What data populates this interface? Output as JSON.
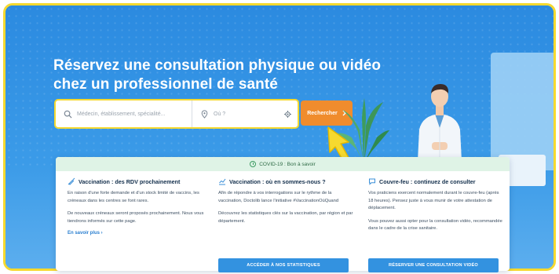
{
  "hero": {
    "headline_line1": "Réservez une consultation physique ou vidéo",
    "headline_line2": "chez un professionnel de santé"
  },
  "search": {
    "query_placeholder": "Médecin, établissement, spécialité...",
    "location_placeholder": "Où ?",
    "button_label": "Rechercher"
  },
  "banner": {
    "text": "COVID-19 : Bon à savoir"
  },
  "cards": [
    {
      "title": "Vaccination : des RDV prochainement",
      "icon": "syringe-icon",
      "paragraphs": [
        "En raison d'une forte demande et d'un stock limité de vaccins, les créneaux dans les centres se font rares.",
        "De nouveaux créneaux seront proposés prochainement. Nous vous tiendrons informés sur cette page."
      ],
      "link": "En savoir plus"
    },
    {
      "title": "Vaccination : où en sommes-nous ?",
      "icon": "chart-icon",
      "paragraphs": [
        "Afin de répondre à vos interrogations sur le rythme de la vaccination, Doctolib lance l'initiative #VaccinationOùQuand",
        "Découvrez les statistiques clés sur la vaccination, par région et par département."
      ],
      "button": "ACCÉDER À NOS STATISTIQUES"
    },
    {
      "title": "Couvre-feu : continuez de consulter",
      "icon": "chat-icon",
      "paragraphs": [
        "Vos praticiens exercent normalement durant le couvre-feu (après 18 heures). Pensez juste à vous munir de votre attestation de déplacement.",
        "Vous pouvez aussi opter pour la consultation vidéo, recommandée dans le cadre de la crise sanitaire."
      ],
      "button": "RÉSERVER UNE CONSULTATION VIDÉO"
    }
  ],
  "colors": {
    "hero_blue": "#2f8fde",
    "accent_orange": "#f08c2d",
    "highlight_yellow": "#f6d92f",
    "covid_green_bg": "#dff3e6",
    "cta_blue": "#3392e0"
  }
}
